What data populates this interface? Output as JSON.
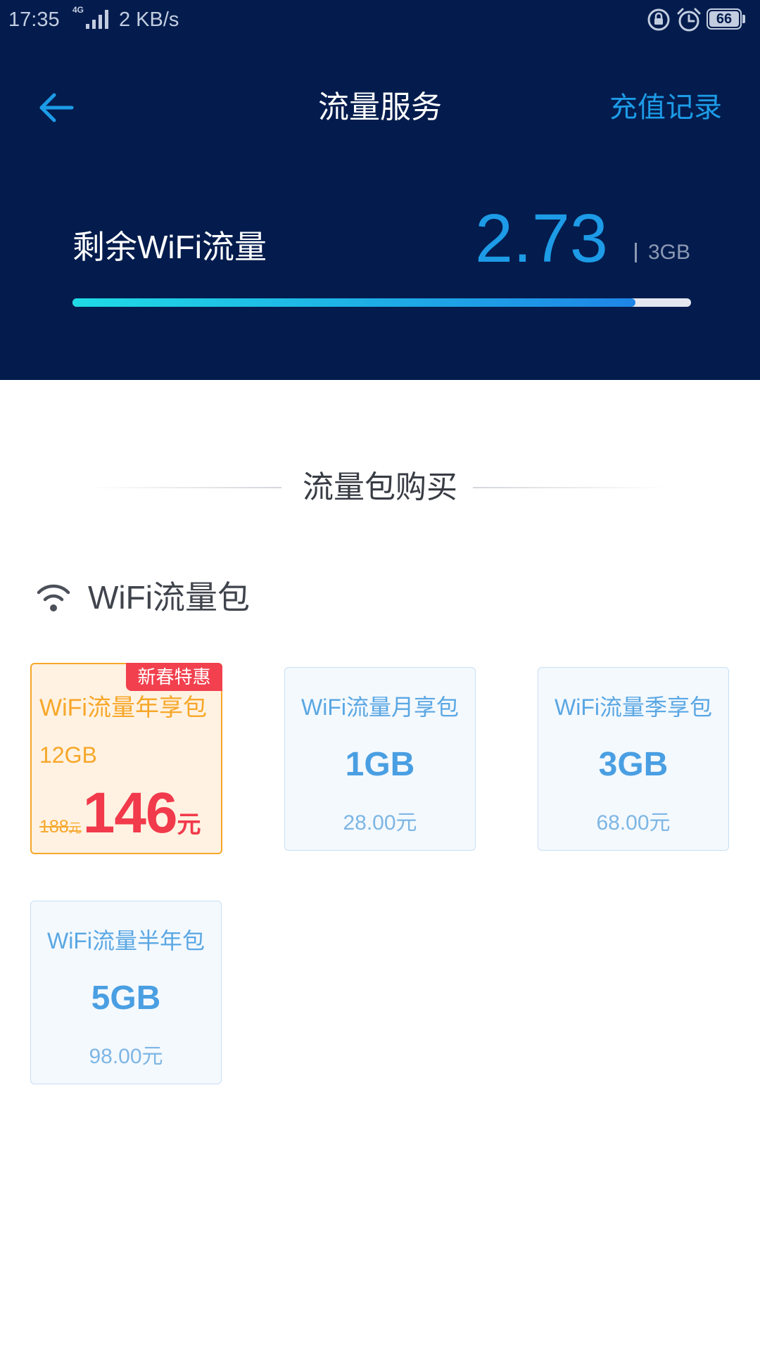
{
  "status_bar": {
    "time": "17:35",
    "network_type": "4G",
    "speed": "2 KB/s",
    "battery_level": "66",
    "icons": [
      "signal-icon",
      "rotation-lock-icon",
      "alarm-icon",
      "battery-icon"
    ]
  },
  "header": {
    "back_icon": "back-arrow-icon",
    "title": "流量服务",
    "recharge_history": "充值记录"
  },
  "usage": {
    "label": "剩余WiFi流量",
    "remaining": "2.73",
    "total": "3GB",
    "progress": 0.91
  },
  "purchase_section": {
    "title": "流量包购买"
  },
  "category": {
    "icon": "wifi-icon",
    "title": "WiFi流量包"
  },
  "packages": [
    {
      "name": "WiFi流量年享包",
      "badge": "新春特惠",
      "size": "12GB",
      "original_price": "188",
      "original_price_unit": "元",
      "price": "146",
      "price_unit": "元",
      "highlighted": true
    },
    {
      "name": "WiFi流量月享包",
      "size": "1GB",
      "price": "28.00元",
      "highlighted": false
    },
    {
      "name": "WiFi流量季享包",
      "size": "3GB",
      "price": "68.00元",
      "highlighted": false
    },
    {
      "name": "WiFi流量半年包",
      "size": "5GB",
      "price": "98.00元",
      "highlighted": false
    }
  ],
  "colors": {
    "header_bg": "#031c4d",
    "accent": "#1d9be7",
    "progress_start": "#1fdbe5",
    "progress_end": "#1e86e6",
    "highlight": "#f7a72a",
    "highlight_bg": "#fff2e2",
    "badge": "#f2404e",
    "price_red": "#f13a4b",
    "card_bg": "#f4f9fe",
    "card_border": "#c9def2",
    "card_name": "#5aa7e3",
    "card_size": "#4a9fe2",
    "card_price": "#7db6e4"
  }
}
